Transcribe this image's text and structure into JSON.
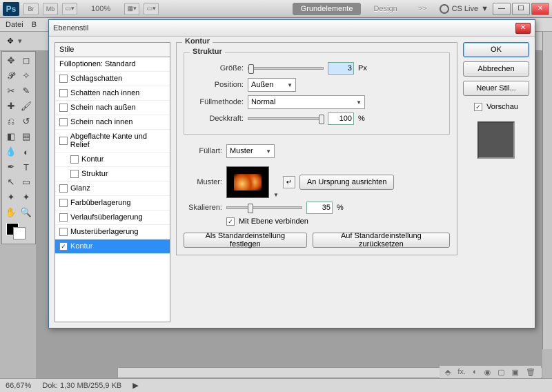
{
  "top": {
    "zoom": "100%",
    "tab_active": "Grundelemente",
    "tab2": "Design",
    "more": ">>",
    "cslive": "CS Live"
  },
  "menu": {
    "file": "Datei",
    "b": "B"
  },
  "status": {
    "zoom": "66,67%",
    "doc": "Dok: 1,30 MB/255,9 KB"
  },
  "dialog": {
    "title": "Ebenenstil",
    "styles_head": "Stile",
    "fill_opts": "Fülloptionen: Standard",
    "items": [
      {
        "label": "Schlagschatten",
        "checked": false,
        "indent": false
      },
      {
        "label": "Schatten nach innen",
        "checked": false,
        "indent": false
      },
      {
        "label": "Schein nach außen",
        "checked": false,
        "indent": false
      },
      {
        "label": "Schein nach innen",
        "checked": false,
        "indent": false
      },
      {
        "label": "Abgeflachte Kante und Relief",
        "checked": false,
        "indent": false
      },
      {
        "label": "Kontur",
        "checked": false,
        "indent": true
      },
      {
        "label": "Struktur",
        "checked": false,
        "indent": true
      },
      {
        "label": "Glanz",
        "checked": false,
        "indent": false
      },
      {
        "label": "Farbüberlagerung",
        "checked": false,
        "indent": false
      },
      {
        "label": "Verlaufsüberlagerung",
        "checked": false,
        "indent": false
      },
      {
        "label": "Musterüberlagerung",
        "checked": false,
        "indent": false
      },
      {
        "label": "Kontur",
        "checked": true,
        "indent": false,
        "selected": true
      }
    ],
    "section": "Kontur",
    "struct": "Struktur",
    "size_label": "Größe:",
    "size_val": "3",
    "px": "Px",
    "pos_label": "Position:",
    "pos_val": "Außen",
    "blend_label": "Füllmethode:",
    "blend_val": "Normal",
    "opac_label": "Deckkraft:",
    "opac_val": "100",
    "pct": "%",
    "filltype_label": "Füllart:",
    "filltype_val": "Muster",
    "pattern_label": "Muster:",
    "snap_btn": "An Ursprung ausrichten",
    "scale_label": "Skalieren:",
    "scale_val": "35",
    "link_layer": "Mit Ebene verbinden",
    "make_default": "Als Standardeinstellung festlegen",
    "reset_default": "Auf Standardeinstellung zurücksetzen",
    "ok": "OK",
    "cancel": "Abbrechen",
    "new_style": "Neuer Stil...",
    "preview": "Vorschau"
  }
}
